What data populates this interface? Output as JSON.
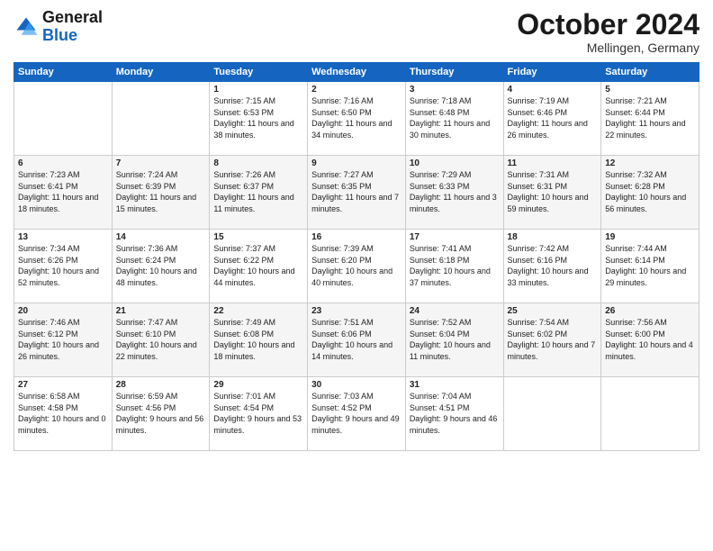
{
  "logo": {
    "line1": "General",
    "line2": "Blue"
  },
  "header": {
    "month": "October 2024",
    "location": "Mellingen, Germany"
  },
  "weekdays": [
    "Sunday",
    "Monday",
    "Tuesday",
    "Wednesday",
    "Thursday",
    "Friday",
    "Saturday"
  ],
  "weeks": [
    [
      {
        "day": "",
        "sunrise": "",
        "sunset": "",
        "daylight": ""
      },
      {
        "day": "",
        "sunrise": "",
        "sunset": "",
        "daylight": ""
      },
      {
        "day": "1",
        "sunrise": "Sunrise: 7:15 AM",
        "sunset": "Sunset: 6:53 PM",
        "daylight": "Daylight: 11 hours and 38 minutes."
      },
      {
        "day": "2",
        "sunrise": "Sunrise: 7:16 AM",
        "sunset": "Sunset: 6:50 PM",
        "daylight": "Daylight: 11 hours and 34 minutes."
      },
      {
        "day": "3",
        "sunrise": "Sunrise: 7:18 AM",
        "sunset": "Sunset: 6:48 PM",
        "daylight": "Daylight: 11 hours and 30 minutes."
      },
      {
        "day": "4",
        "sunrise": "Sunrise: 7:19 AM",
        "sunset": "Sunset: 6:46 PM",
        "daylight": "Daylight: 11 hours and 26 minutes."
      },
      {
        "day": "5",
        "sunrise": "Sunrise: 7:21 AM",
        "sunset": "Sunset: 6:44 PM",
        "daylight": "Daylight: 11 hours and 22 minutes."
      }
    ],
    [
      {
        "day": "6",
        "sunrise": "Sunrise: 7:23 AM",
        "sunset": "Sunset: 6:41 PM",
        "daylight": "Daylight: 11 hours and 18 minutes."
      },
      {
        "day": "7",
        "sunrise": "Sunrise: 7:24 AM",
        "sunset": "Sunset: 6:39 PM",
        "daylight": "Daylight: 11 hours and 15 minutes."
      },
      {
        "day": "8",
        "sunrise": "Sunrise: 7:26 AM",
        "sunset": "Sunset: 6:37 PM",
        "daylight": "Daylight: 11 hours and 11 minutes."
      },
      {
        "day": "9",
        "sunrise": "Sunrise: 7:27 AM",
        "sunset": "Sunset: 6:35 PM",
        "daylight": "Daylight: 11 hours and 7 minutes."
      },
      {
        "day": "10",
        "sunrise": "Sunrise: 7:29 AM",
        "sunset": "Sunset: 6:33 PM",
        "daylight": "Daylight: 11 hours and 3 minutes."
      },
      {
        "day": "11",
        "sunrise": "Sunrise: 7:31 AM",
        "sunset": "Sunset: 6:31 PM",
        "daylight": "Daylight: 10 hours and 59 minutes."
      },
      {
        "day": "12",
        "sunrise": "Sunrise: 7:32 AM",
        "sunset": "Sunset: 6:28 PM",
        "daylight": "Daylight: 10 hours and 56 minutes."
      }
    ],
    [
      {
        "day": "13",
        "sunrise": "Sunrise: 7:34 AM",
        "sunset": "Sunset: 6:26 PM",
        "daylight": "Daylight: 10 hours and 52 minutes."
      },
      {
        "day": "14",
        "sunrise": "Sunrise: 7:36 AM",
        "sunset": "Sunset: 6:24 PM",
        "daylight": "Daylight: 10 hours and 48 minutes."
      },
      {
        "day": "15",
        "sunrise": "Sunrise: 7:37 AM",
        "sunset": "Sunset: 6:22 PM",
        "daylight": "Daylight: 10 hours and 44 minutes."
      },
      {
        "day": "16",
        "sunrise": "Sunrise: 7:39 AM",
        "sunset": "Sunset: 6:20 PM",
        "daylight": "Daylight: 10 hours and 40 minutes."
      },
      {
        "day": "17",
        "sunrise": "Sunrise: 7:41 AM",
        "sunset": "Sunset: 6:18 PM",
        "daylight": "Daylight: 10 hours and 37 minutes."
      },
      {
        "day": "18",
        "sunrise": "Sunrise: 7:42 AM",
        "sunset": "Sunset: 6:16 PM",
        "daylight": "Daylight: 10 hours and 33 minutes."
      },
      {
        "day": "19",
        "sunrise": "Sunrise: 7:44 AM",
        "sunset": "Sunset: 6:14 PM",
        "daylight": "Daylight: 10 hours and 29 minutes."
      }
    ],
    [
      {
        "day": "20",
        "sunrise": "Sunrise: 7:46 AM",
        "sunset": "Sunset: 6:12 PM",
        "daylight": "Daylight: 10 hours and 26 minutes."
      },
      {
        "day": "21",
        "sunrise": "Sunrise: 7:47 AM",
        "sunset": "Sunset: 6:10 PM",
        "daylight": "Daylight: 10 hours and 22 minutes."
      },
      {
        "day": "22",
        "sunrise": "Sunrise: 7:49 AM",
        "sunset": "Sunset: 6:08 PM",
        "daylight": "Daylight: 10 hours and 18 minutes."
      },
      {
        "day": "23",
        "sunrise": "Sunrise: 7:51 AM",
        "sunset": "Sunset: 6:06 PM",
        "daylight": "Daylight: 10 hours and 14 minutes."
      },
      {
        "day": "24",
        "sunrise": "Sunrise: 7:52 AM",
        "sunset": "Sunset: 6:04 PM",
        "daylight": "Daylight: 10 hours and 11 minutes."
      },
      {
        "day": "25",
        "sunrise": "Sunrise: 7:54 AM",
        "sunset": "Sunset: 6:02 PM",
        "daylight": "Daylight: 10 hours and 7 minutes."
      },
      {
        "day": "26",
        "sunrise": "Sunrise: 7:56 AM",
        "sunset": "Sunset: 6:00 PM",
        "daylight": "Daylight: 10 hours and 4 minutes."
      }
    ],
    [
      {
        "day": "27",
        "sunrise": "Sunrise: 6:58 AM",
        "sunset": "Sunset: 4:58 PM",
        "daylight": "Daylight: 10 hours and 0 minutes."
      },
      {
        "day": "28",
        "sunrise": "Sunrise: 6:59 AM",
        "sunset": "Sunset: 4:56 PM",
        "daylight": "Daylight: 9 hours and 56 minutes."
      },
      {
        "day": "29",
        "sunrise": "Sunrise: 7:01 AM",
        "sunset": "Sunset: 4:54 PM",
        "daylight": "Daylight: 9 hours and 53 minutes."
      },
      {
        "day": "30",
        "sunrise": "Sunrise: 7:03 AM",
        "sunset": "Sunset: 4:52 PM",
        "daylight": "Daylight: 9 hours and 49 minutes."
      },
      {
        "day": "31",
        "sunrise": "Sunrise: 7:04 AM",
        "sunset": "Sunset: 4:51 PM",
        "daylight": "Daylight: 9 hours and 46 minutes."
      },
      {
        "day": "",
        "sunrise": "",
        "sunset": "",
        "daylight": ""
      },
      {
        "day": "",
        "sunrise": "",
        "sunset": "",
        "daylight": ""
      }
    ]
  ]
}
